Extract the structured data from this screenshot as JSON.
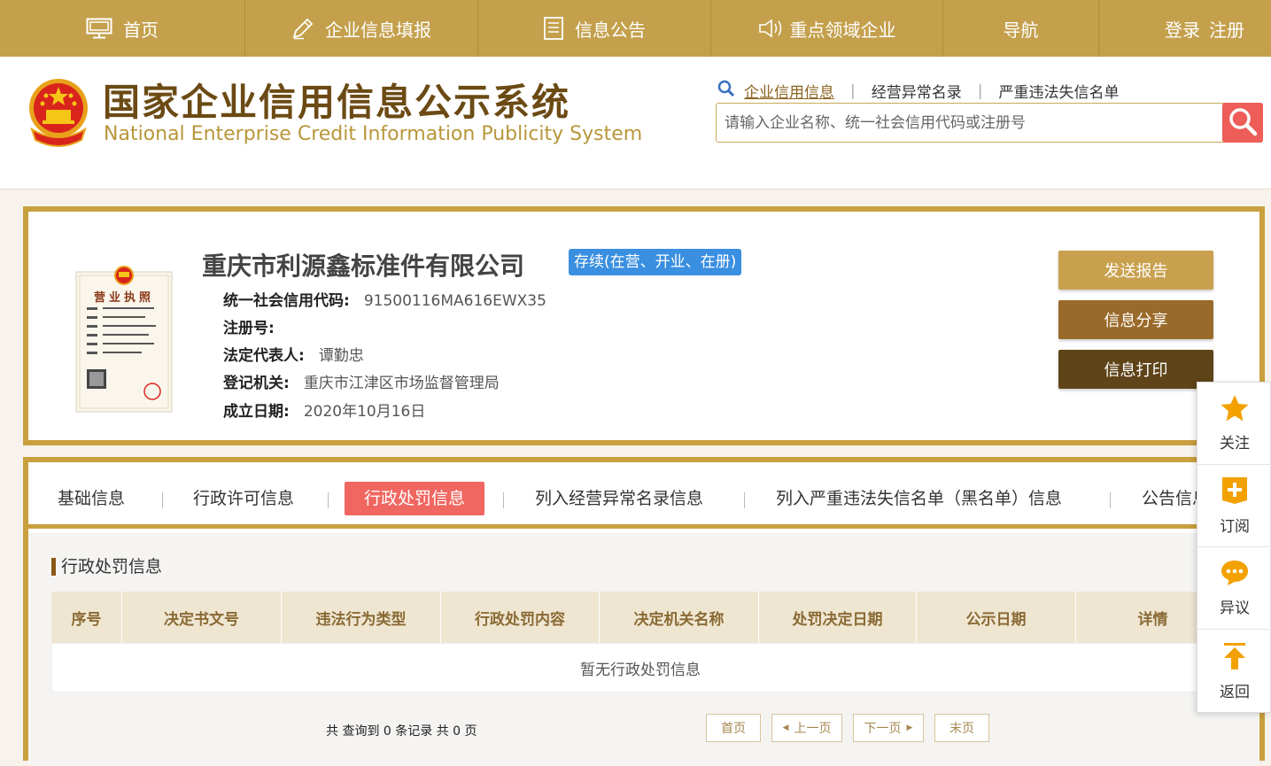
{
  "nav": {
    "home": "首页",
    "report": "企业信息填报",
    "notice": "信息公告",
    "key_field": "重点领域企业",
    "guide": "导航",
    "login": "登录",
    "register": "注册"
  },
  "header": {
    "title_cn": "国家企业信用信息公示系统",
    "title_en": "National Enterprise Credit Information Publicity System",
    "search_tabs": [
      "企业信用信息",
      "经营异常名录",
      "严重违法失信名单"
    ],
    "search_placeholder": "请输入企业名称、统一社会信用代码或注册号"
  },
  "company": {
    "name": "重庆市利源鑫标准件有限公司",
    "status": "存续(在营、开业、在册)",
    "credit_code_label": "统一社会信用代码:",
    "credit_code": "91500116MA616EWX35",
    "reg_no_label": "注册号:",
    "reg_no": "",
    "legal_rep_label": "法定代表人:",
    "legal_rep": "谭勤忠",
    "authority_label": "登记机关:",
    "authority": "重庆市江津区市场监督管理局",
    "founded_label": "成立日期:",
    "founded": "2020年10月16日",
    "license_title": "营业执照"
  },
  "actions": {
    "send": "发送报告",
    "share": "信息分享",
    "print": "信息打印"
  },
  "tabs": [
    "基础信息",
    "行政许可信息",
    "行政处罚信息",
    "列入经营异常名录信息",
    "列入严重违法失信名单（黑名单）信息",
    "公告信息"
  ],
  "section": {
    "title": "行政处罚信息",
    "columns": [
      "序号",
      "决定书文号",
      "违法行为类型",
      "行政处罚内容",
      "决定机关名称",
      "处罚决定日期",
      "公示日期",
      "详情"
    ],
    "empty": "暂无行政处罚信息"
  },
  "pager": {
    "summary": "共 查询到 0 条记录 共 0 页",
    "first": "首页",
    "prev": "上一页",
    "next": "下一页",
    "last": "末页"
  },
  "side": {
    "follow": "关注",
    "subscribe": "订阅",
    "objection": "异议",
    "back": "返回"
  },
  "colors": {
    "gold": "#c4a04c",
    "brown": "#6b4a14",
    "red": "#f06660",
    "blue": "#3a8fe0",
    "send_btn": "#c9a14e",
    "share_btn": "#9a6a2a",
    "print_btn": "#5e4418",
    "icon_orange": "#f2a100"
  }
}
